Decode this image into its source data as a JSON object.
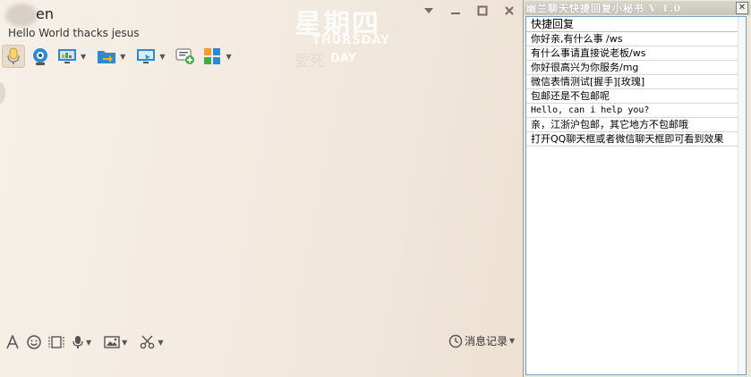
{
  "chat": {
    "contact_name": "en",
    "signature": "Hello World thacks jesus",
    "watermark": {
      "day_cn": "星期四",
      "day_en": "THURSDAY",
      "tag_cn": "愛死",
      "tag_en": "DAY"
    },
    "window_controls": [
      "chevron-down-icon",
      "minimize-icon",
      "maximize-icon",
      "close-icon"
    ],
    "toolbar": [
      "microphone-icon",
      "camera-icon",
      "screen-share-icon",
      "file-transfer-icon",
      "remote-desktop-icon",
      "add-message-icon",
      "apps-grid-icon"
    ],
    "input_toolbar": [
      "font-icon",
      "emoji-icon",
      "screenshot-icon",
      "voice-icon",
      "image-icon",
      "scissors-icon"
    ],
    "history_label": "消息记录"
  },
  "panel": {
    "title": "幽兰聊天快捷回复小秘书 V 1.0",
    "close_label": "✕",
    "header": "快捷回复",
    "items": [
      "你好亲,有什么事 /ws",
      "有什么事请直接说老板/ws",
      "你好很高兴为你服务/mg",
      "微信表情测试[握手][玫瑰]",
      "包邮还是不包邮呢",
      "Hello, can i help you?",
      "亲，江浙沪包邮，其它地方不包邮哦",
      "打开QQ聊天框或者微信聊天框即可看到效果"
    ]
  },
  "colors": {
    "accent_blue": "#2a8ad4",
    "panel_bg": "#ece9d8",
    "chat_bg": "#f3ebe1"
  }
}
